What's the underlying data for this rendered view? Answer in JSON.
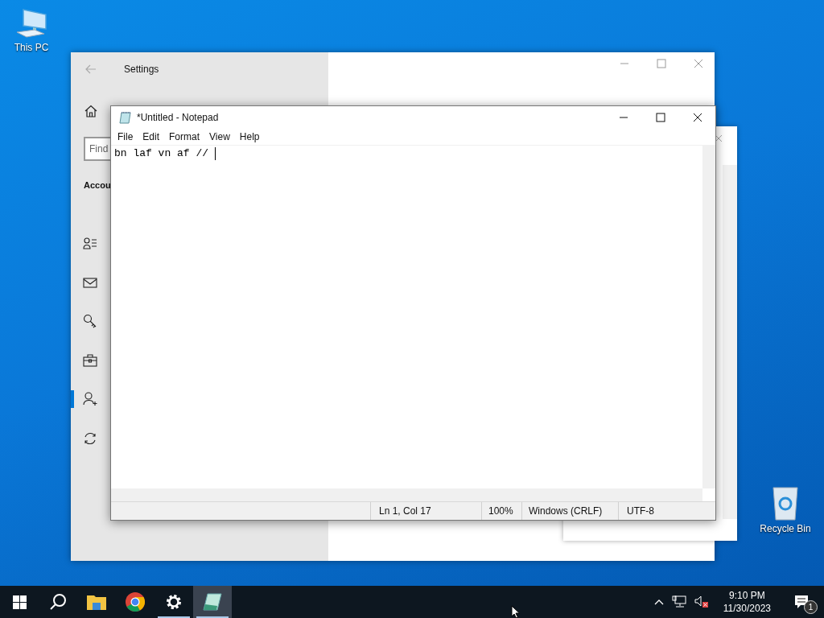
{
  "desktop_icons": [
    {
      "label": "This PC",
      "kind": "computer"
    },
    {
      "label": "Recycle Bin",
      "kind": "recycle-bin"
    }
  ],
  "settings_window": {
    "title": "Settings",
    "search": {
      "placeholder": "Find"
    },
    "section_heading": "Accou",
    "nav": [
      {
        "kind": "person-list",
        "selected": false
      },
      {
        "kind": "mail",
        "selected": false
      },
      {
        "kind": "key",
        "selected": false
      },
      {
        "kind": "briefcase",
        "selected": false
      },
      {
        "kind": "person-add",
        "selected": true
      },
      {
        "kind": "sync",
        "selected": false
      }
    ]
  },
  "notepad": {
    "title": "*Untitled - Notepad",
    "menu": [
      "File",
      "Edit",
      "Format",
      "View",
      "Help"
    ],
    "text": "bn laf vn af // ",
    "status": [
      "Ln 1, Col 17",
      "100%",
      "Windows (CRLF)",
      "UTF-8"
    ]
  },
  "taskbar": {
    "apps": [
      {
        "kind": "file-explorer",
        "open": false,
        "selected": false
      },
      {
        "kind": "browser",
        "open": false,
        "selected": false
      },
      {
        "kind": "settings",
        "open": true,
        "selected": false
      },
      {
        "kind": "notepad",
        "open": true,
        "selected": true
      }
    ],
    "time": "9:10 PM",
    "date": "11/30/2023",
    "notification_count": "1"
  }
}
